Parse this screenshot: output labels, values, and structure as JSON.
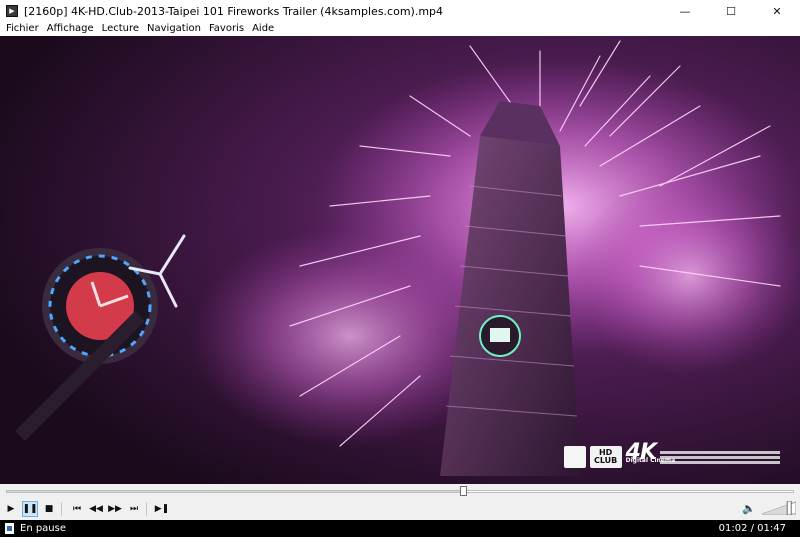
{
  "window": {
    "title": "[2160p] 4K-HD.Club-2013-Taipei 101 Fireworks Trailer (4ksamples.com).mp4",
    "controls": {
      "minimize": "—",
      "maximize": "☐",
      "close": "✕"
    }
  },
  "menu": {
    "items": [
      {
        "label": "Fichier"
      },
      {
        "label": "Affichage"
      },
      {
        "label": "Lecture"
      },
      {
        "label": "Navigation"
      },
      {
        "label": "Favoris"
      },
      {
        "label": "Aide"
      }
    ]
  },
  "video": {
    "overlay": {
      "club_label": "HD CLUB",
      "brand": "4K",
      "brand_sub": "Digital Cinema"
    }
  },
  "seek": {
    "position_fraction": 0.58
  },
  "toolbar": {
    "buttons": [
      {
        "name": "play-button",
        "glyph": "▶"
      },
      {
        "name": "pause-button",
        "glyph": "❚❚",
        "active": true
      },
      {
        "name": "stop-button",
        "glyph": "■"
      },
      {
        "name": "previous-button",
        "glyph": "⏮"
      },
      {
        "name": "rewind-button",
        "glyph": "◀◀"
      },
      {
        "name": "fast-forward-button",
        "glyph": "▶▶"
      },
      {
        "name": "next-button",
        "glyph": "⏭"
      },
      {
        "name": "frame-step-button",
        "glyph": "▶❚"
      }
    ],
    "volume_icon": "🔈",
    "volume_fraction": 0.8
  },
  "status": {
    "state": "En pause",
    "time": "01:02 / 01:47"
  },
  "colors": {
    "accent_active": "#cde6f7",
    "status_bg": "#000000",
    "volume_icon": "#6a8a1f"
  }
}
